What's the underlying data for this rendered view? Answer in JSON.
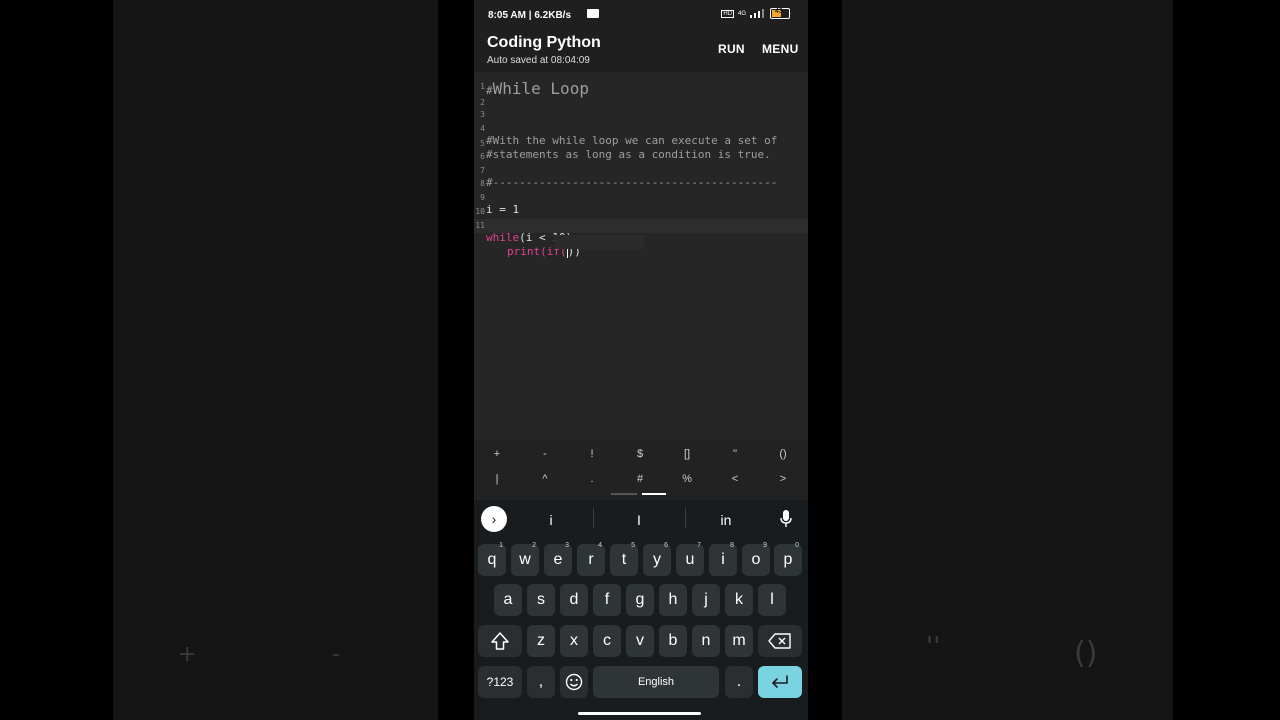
{
  "status": {
    "time": "8:05 AM | 6.2KB/s",
    "network": "4G",
    "battery": "43"
  },
  "app": {
    "title": "Coding Python",
    "autosave": "Auto saved at 08:04:09",
    "run_label": "RUN",
    "menu_label": "MENU"
  },
  "editor": {
    "lines": [
      {
        "num": "1",
        "text": "#While Loop"
      },
      {
        "num": "2",
        "text": ""
      },
      {
        "num": "3",
        "text": "#With the while loop we can execute a set of"
      },
      {
        "num": "4",
        "text": "#statements as long as a condition is true."
      },
      {
        "num": "5",
        "text": ""
      },
      {
        "num": "6",
        "text": "#-------------------------------------------"
      },
      {
        "num": "7",
        "text": ""
      },
      {
        "num": "8",
        "text": "i = 1"
      },
      {
        "num": "9",
        "text": ""
      },
      {
        "num": "10",
        "text": "while(i < 10):"
      },
      {
        "num": "11",
        "text": "print(if())"
      }
    ],
    "line1_hash": "#",
    "line1_heading": "While Loop",
    "line10_kw": "while",
    "line10_rest": "(i < 10):",
    "line11_kw": "print",
    "line11_a": "(",
    "line11_if": "if(",
    "line11_b": ")",
    "line11_c": ")"
  },
  "symbols": {
    "row1": [
      "+",
      "-",
      "!",
      "$",
      "[]",
      "''",
      "()"
    ],
    "row2": [
      "|",
      "^",
      ".",
      "#",
      "%",
      "<",
      ">"
    ]
  },
  "keyboard": {
    "suggestions": [
      "i",
      "I",
      "in"
    ],
    "row1": [
      {
        "k": "q",
        "n": "1"
      },
      {
        "k": "w",
        "n": "2"
      },
      {
        "k": "e",
        "n": "3"
      },
      {
        "k": "r",
        "n": "4"
      },
      {
        "k": "t",
        "n": "5"
      },
      {
        "k": "y",
        "n": "6"
      },
      {
        "k": "u",
        "n": "7"
      },
      {
        "k": "i",
        "n": "8"
      },
      {
        "k": "o",
        "n": "9"
      },
      {
        "k": "p",
        "n": "0"
      }
    ],
    "row2": [
      "a",
      "s",
      "d",
      "f",
      "g",
      "h",
      "j",
      "k",
      "l"
    ],
    "row3": [
      "z",
      "x",
      "c",
      "v",
      "b",
      "n",
      "m"
    ],
    "symbols_key": "?123",
    "comma_key": ",",
    "space_label": "English",
    "period_key": "."
  },
  "background": {
    "ghost_left": [
      "+",
      "-"
    ],
    "ghost_right": [
      "''",
      "()"
    ]
  },
  "colors": {
    "keyword": "#e3408f",
    "enter_key": "#7ad3e0",
    "battery": "#f4a82b"
  }
}
